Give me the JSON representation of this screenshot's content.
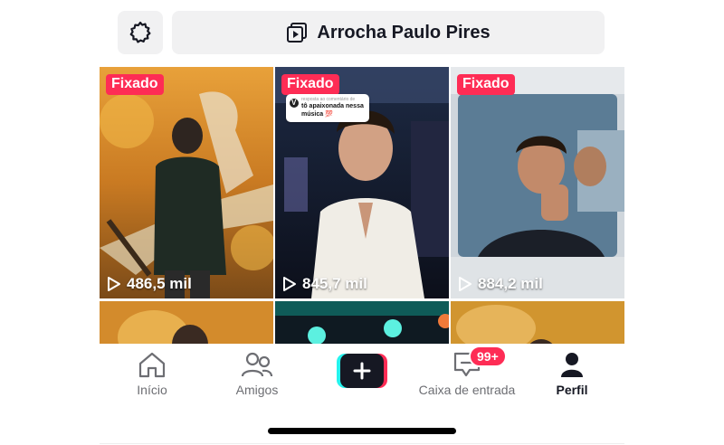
{
  "top_bar": {
    "settings_icon": "gear-icon",
    "playlist_icon": "video-playlist-icon",
    "playlist_title": "Arrocha Paulo Pires"
  },
  "videos": [
    {
      "pinned_label": "Fixado",
      "views": "486,5 mil"
    },
    {
      "pinned_label": "Fixado",
      "views": "845,7 mil",
      "caption_sub": "resposta ao comentário de",
      "caption_text": "tô apaixonada nessa música 💯"
    },
    {
      "pinned_label": "Fixado",
      "views": "884,2 mil"
    }
  ],
  "tab_bar": {
    "home_label": "Início",
    "friends_label": "Amigos",
    "create_icon": "plus-icon",
    "inbox_label": "Caixa de entrada",
    "inbox_badge": "99+",
    "profile_label": "Perfil",
    "active_tab": "Perfil"
  },
  "colors": {
    "accent": "#fe2c55",
    "cyan": "#25f4ee",
    "dark": "#161823",
    "surface": "#f1f1f2"
  }
}
